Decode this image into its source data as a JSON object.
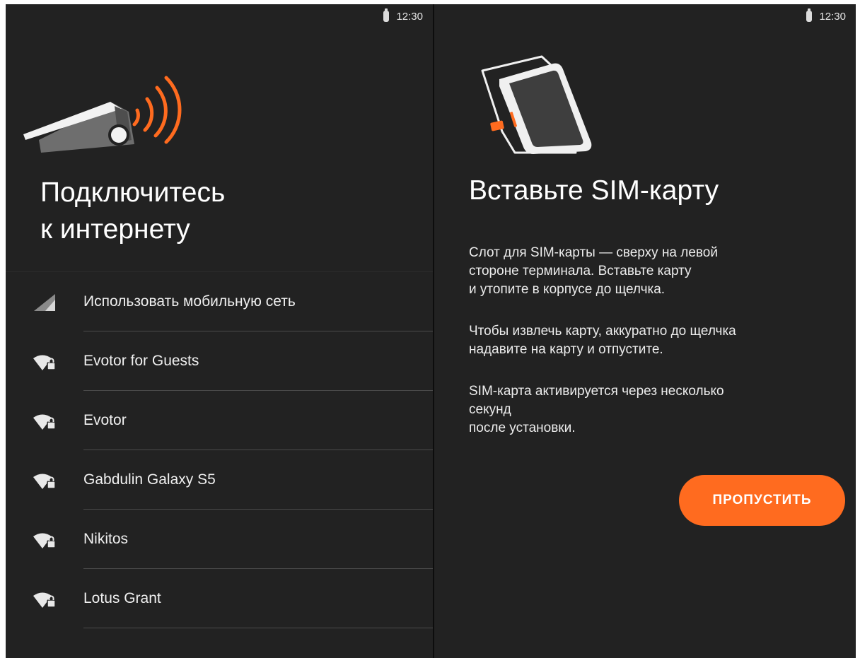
{
  "status_bar": {
    "time": "12:30"
  },
  "left_panel": {
    "title_line1": "Подключитесь",
    "title_line2": "к интернету",
    "networks": [
      {
        "label": "Использовать мобильную сеть",
        "icon": "cellular-signal-icon"
      },
      {
        "label": "Evotor for Guests",
        "icon": "wifi-locked-icon"
      },
      {
        "label": "Evotor",
        "icon": "wifi-locked-icon"
      },
      {
        "label": "Gabdulin Galaxy S5",
        "icon": "wifi-locked-icon"
      },
      {
        "label": "Nikitos",
        "icon": "wifi-locked-icon"
      },
      {
        "label": "Lotus Grant",
        "icon": "wifi-locked-icon"
      }
    ]
  },
  "right_panel": {
    "title": "Вставьте SIM-карту",
    "paragraph1": "Слот для SIM-карты — сверху на левой\nстороне терминала. Вставьте карту\nи утопите в корпусе до щелчка.",
    "paragraph2": "Чтобы извлечь карту, аккуратно до щелчка\nнадавите на карту и отпустите.",
    "paragraph3": "SIM-карта активируется через несколько\nсекунд\nпосле установки.",
    "skip_label": "ПРОПУСТИТЬ"
  },
  "colors": {
    "accent": "#ff6b1f",
    "background": "#222222",
    "divider": "#4a4a4a",
    "text": "#ffffff"
  }
}
